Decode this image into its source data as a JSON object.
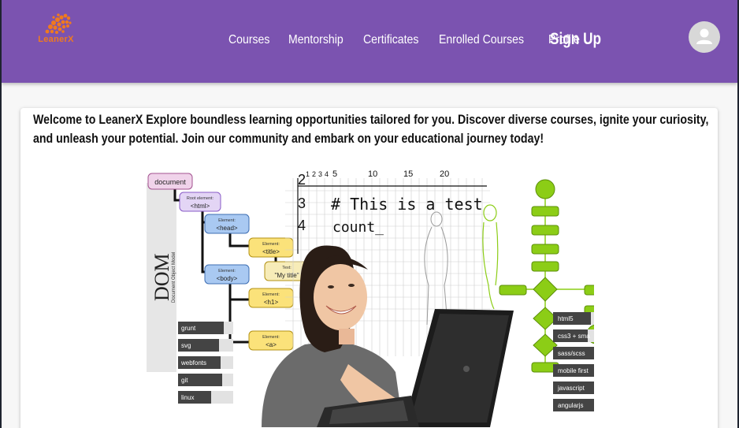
{
  "brand": {
    "name": "LeanerX"
  },
  "nav": {
    "links": [
      "Courses",
      "Mentorship",
      "Certificates",
      "Enrolled Courses",
      "Profile"
    ],
    "signup_label": "Sign Up"
  },
  "main": {
    "welcome_text": "Welcome to LeanerX Explore boundless learning opportunities tailored for you. Discover diverse courses, ignite your curiosity, and unleash your potential. Join our community and embark on your educational journey today!"
  },
  "hero_image": {
    "dom_title": "DOM",
    "dom_subtitle": "Document Object Model",
    "tree_nodes": [
      "document",
      "Root element:",
      "<html>",
      "Element:",
      "<head>",
      "Element:",
      "<title>",
      "Element:",
      "<body>",
      "Text:",
      "\"My title\"",
      "Element:",
      "<h1>",
      "Element:",
      "<a>"
    ],
    "skills_left": [
      "grunt",
      "svg",
      "webfonts",
      "git",
      "linux"
    ],
    "skills_right": [
      "html5",
      "css3 + sma",
      "sass/scss",
      "mobile first",
      "javascript",
      "angularjs"
    ],
    "code_lines": [
      "# This is a test",
      "count_"
    ],
    "axis_ticks": [
      "1",
      "2",
      "3",
      "4",
      "5",
      "10",
      "15",
      "20"
    ],
    "axis_left": [
      "2",
      "3",
      "4"
    ]
  },
  "colors": {
    "navbar": "#7b53b0",
    "brand_orange": "#f07a1e",
    "flow_green": "#8ccd16"
  }
}
